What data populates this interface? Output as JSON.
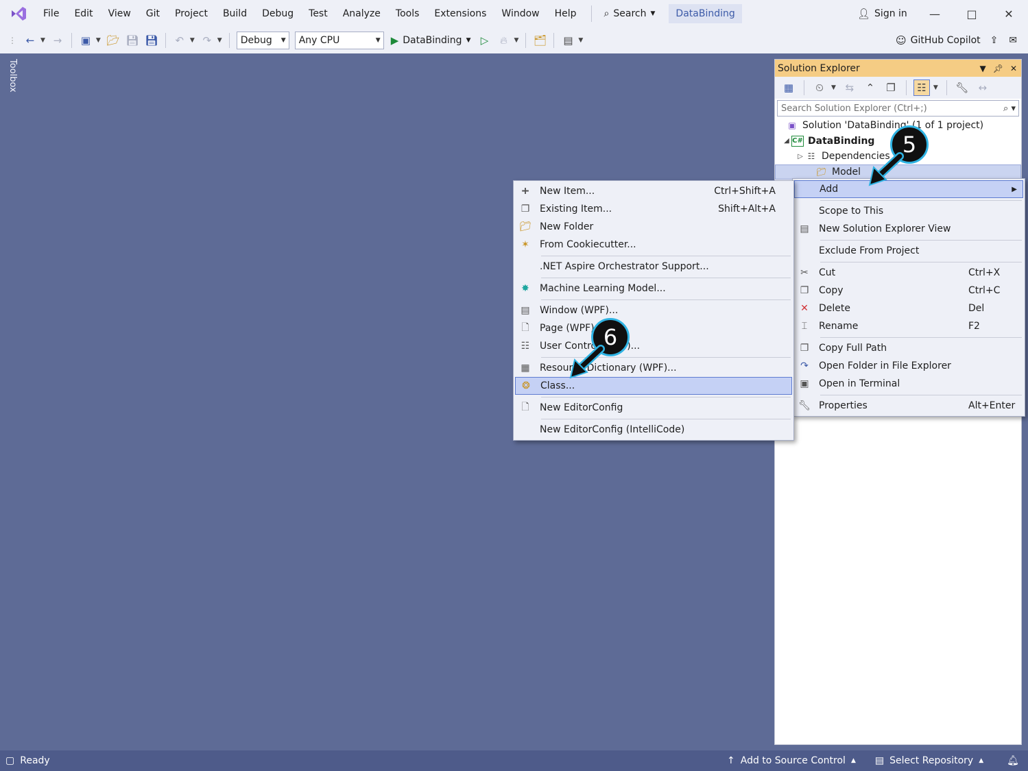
{
  "menubar": {
    "items": [
      "File",
      "Edit",
      "View",
      "Git",
      "Project",
      "Build",
      "Debug",
      "Test",
      "Analyze",
      "Tools",
      "Extensions",
      "Window",
      "Help"
    ],
    "search_label": "Search",
    "solution_name": "DataBinding",
    "sign_in": "Sign in"
  },
  "toolbar": {
    "configuration": "Debug",
    "platform": "Any CPU",
    "run_target": "DataBinding",
    "copilot": "GitHub Copilot"
  },
  "toolbox": {
    "label": "Toolbox"
  },
  "solution_explorer": {
    "title": "Solution Explorer",
    "search_placeholder": "Search Solution Explorer (Ctrl+;)",
    "tree": {
      "solution": "Solution 'DataBinding' (1 of 1 project)",
      "project": "DataBinding",
      "dependencies": "Dependencies",
      "model": "Model"
    }
  },
  "context_menu": {
    "items": [
      {
        "label": "Add",
        "shortcut": ""
      },
      {
        "label": "Scope to This",
        "shortcut": ""
      },
      {
        "label": "New Solution Explorer View",
        "shortcut": ""
      },
      {
        "label": "Exclude From Project",
        "shortcut": ""
      },
      {
        "label": "Cut",
        "shortcut": "Ctrl+X"
      },
      {
        "label": "Copy",
        "shortcut": "Ctrl+C"
      },
      {
        "label": "Delete",
        "shortcut": "Del"
      },
      {
        "label": "Rename",
        "shortcut": "F2"
      },
      {
        "label": "Copy Full Path",
        "shortcut": ""
      },
      {
        "label": "Open Folder in File Explorer",
        "shortcut": ""
      },
      {
        "label": "Open in Terminal",
        "shortcut": ""
      },
      {
        "label": "Properties",
        "shortcut": "Alt+Enter"
      }
    ]
  },
  "add_submenu": {
    "items": [
      {
        "label": "New Item...",
        "shortcut": "Ctrl+Shift+A"
      },
      {
        "label": "Existing Item...",
        "shortcut": "Shift+Alt+A"
      },
      {
        "label": "New Folder",
        "shortcut": ""
      },
      {
        "label": "From Cookiecutter...",
        "shortcut": ""
      },
      {
        "label": ".NET Aspire Orchestrator Support...",
        "shortcut": ""
      },
      {
        "label": "Machine Learning Model...",
        "shortcut": ""
      },
      {
        "label": "Window (WPF)...",
        "shortcut": ""
      },
      {
        "label": "Page (WPF)...",
        "shortcut": ""
      },
      {
        "label": "User Control (WPF)...",
        "shortcut": ""
      },
      {
        "label": "Resource Dictionary (WPF)...",
        "shortcut": ""
      },
      {
        "label": "Class...",
        "shortcut": ""
      },
      {
        "label": "New EditorConfig",
        "shortcut": ""
      },
      {
        "label": "New EditorConfig (IntelliCode)",
        "shortcut": ""
      }
    ]
  },
  "callouts": {
    "step5": "5",
    "step6": "6"
  },
  "statusbar": {
    "status": "Ready",
    "add_source_control": "Add to Source Control",
    "select_repository": "Select Repository"
  },
  "colors": {
    "background": "#5e6b96",
    "accent": "#3c5aa8",
    "panel_title": "#f5cc84",
    "callout_border": "#2fb3e3"
  }
}
